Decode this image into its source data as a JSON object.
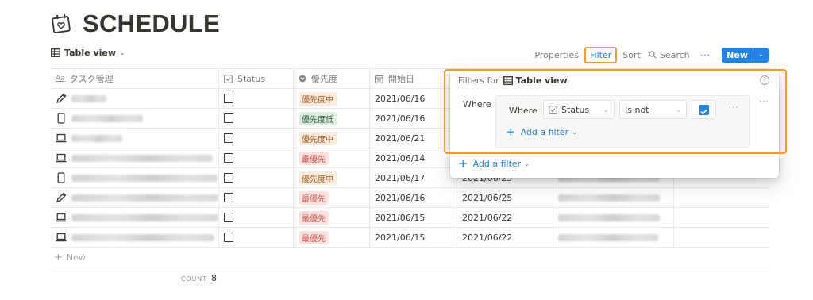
{
  "page": {
    "title": "SCHEDULE",
    "icon": "calendar-heart-icon"
  },
  "viewbar": {
    "view_label": "Table view",
    "toolbar": {
      "properties": "Properties",
      "filter": "Filter",
      "sort": "Sort",
      "search": "Search",
      "more": "···",
      "new": "New"
    }
  },
  "table": {
    "columns": [
      {
        "label": "タスク管理",
        "icon": "Aa"
      },
      {
        "label": "Status",
        "icon": "checkbox-icon"
      },
      {
        "label": "優先度",
        "icon": "select-icon"
      },
      {
        "label": "開始日",
        "icon": "date-icon"
      }
    ],
    "rows": [
      {
        "icon": "pencil-icon",
        "priority": "優先度中",
        "start": "2021/06/16",
        "end": ""
      },
      {
        "icon": "phone-icon",
        "priority": "優先度低",
        "start": "2021/06/16",
        "end": ""
      },
      {
        "icon": "laptop-icon",
        "priority": "優先度中",
        "start": "2021/06/21",
        "end": ""
      },
      {
        "icon": "laptop-icon",
        "priority": "最優先",
        "start": "2021/06/14",
        "end": ""
      },
      {
        "icon": "phone-icon",
        "priority": "優先度中",
        "start": "2021/06/17",
        "end": "2021/06/25"
      },
      {
        "icon": "pencil-icon",
        "priority": "最優先",
        "start": "2021/06/16",
        "end": "2021/06/25"
      },
      {
        "icon": "laptop-icon",
        "priority": "最優先",
        "start": "2021/06/15",
        "end": "2021/06/22"
      },
      {
        "icon": "laptop-icon",
        "priority": "最優先",
        "start": "2021/06/15",
        "end": "2021/06/22"
      }
    ],
    "new_row": "New",
    "count_label": "COUNT",
    "count_value": "8"
  },
  "filter_popup": {
    "label": "Filters for",
    "view": "Table view",
    "help": "?",
    "where_outer": "Where",
    "where_inner": "Where",
    "field": "Status",
    "operator": "Is not",
    "value_checked": true,
    "dots": "···",
    "add_filter_inner": "Add a filter",
    "add_filter_outer": "Add a filter"
  },
  "colors": {
    "accent": "#2383e2",
    "highlight": "#f2993a",
    "tag_mid_bg": "#fbecdd",
    "tag_mid_fg": "#a1551a",
    "tag_low_bg": "#dbeddb",
    "tag_low_fg": "#2b593f",
    "tag_top_bg": "#ffe2dd",
    "tag_top_fg": "#c4554d"
  }
}
